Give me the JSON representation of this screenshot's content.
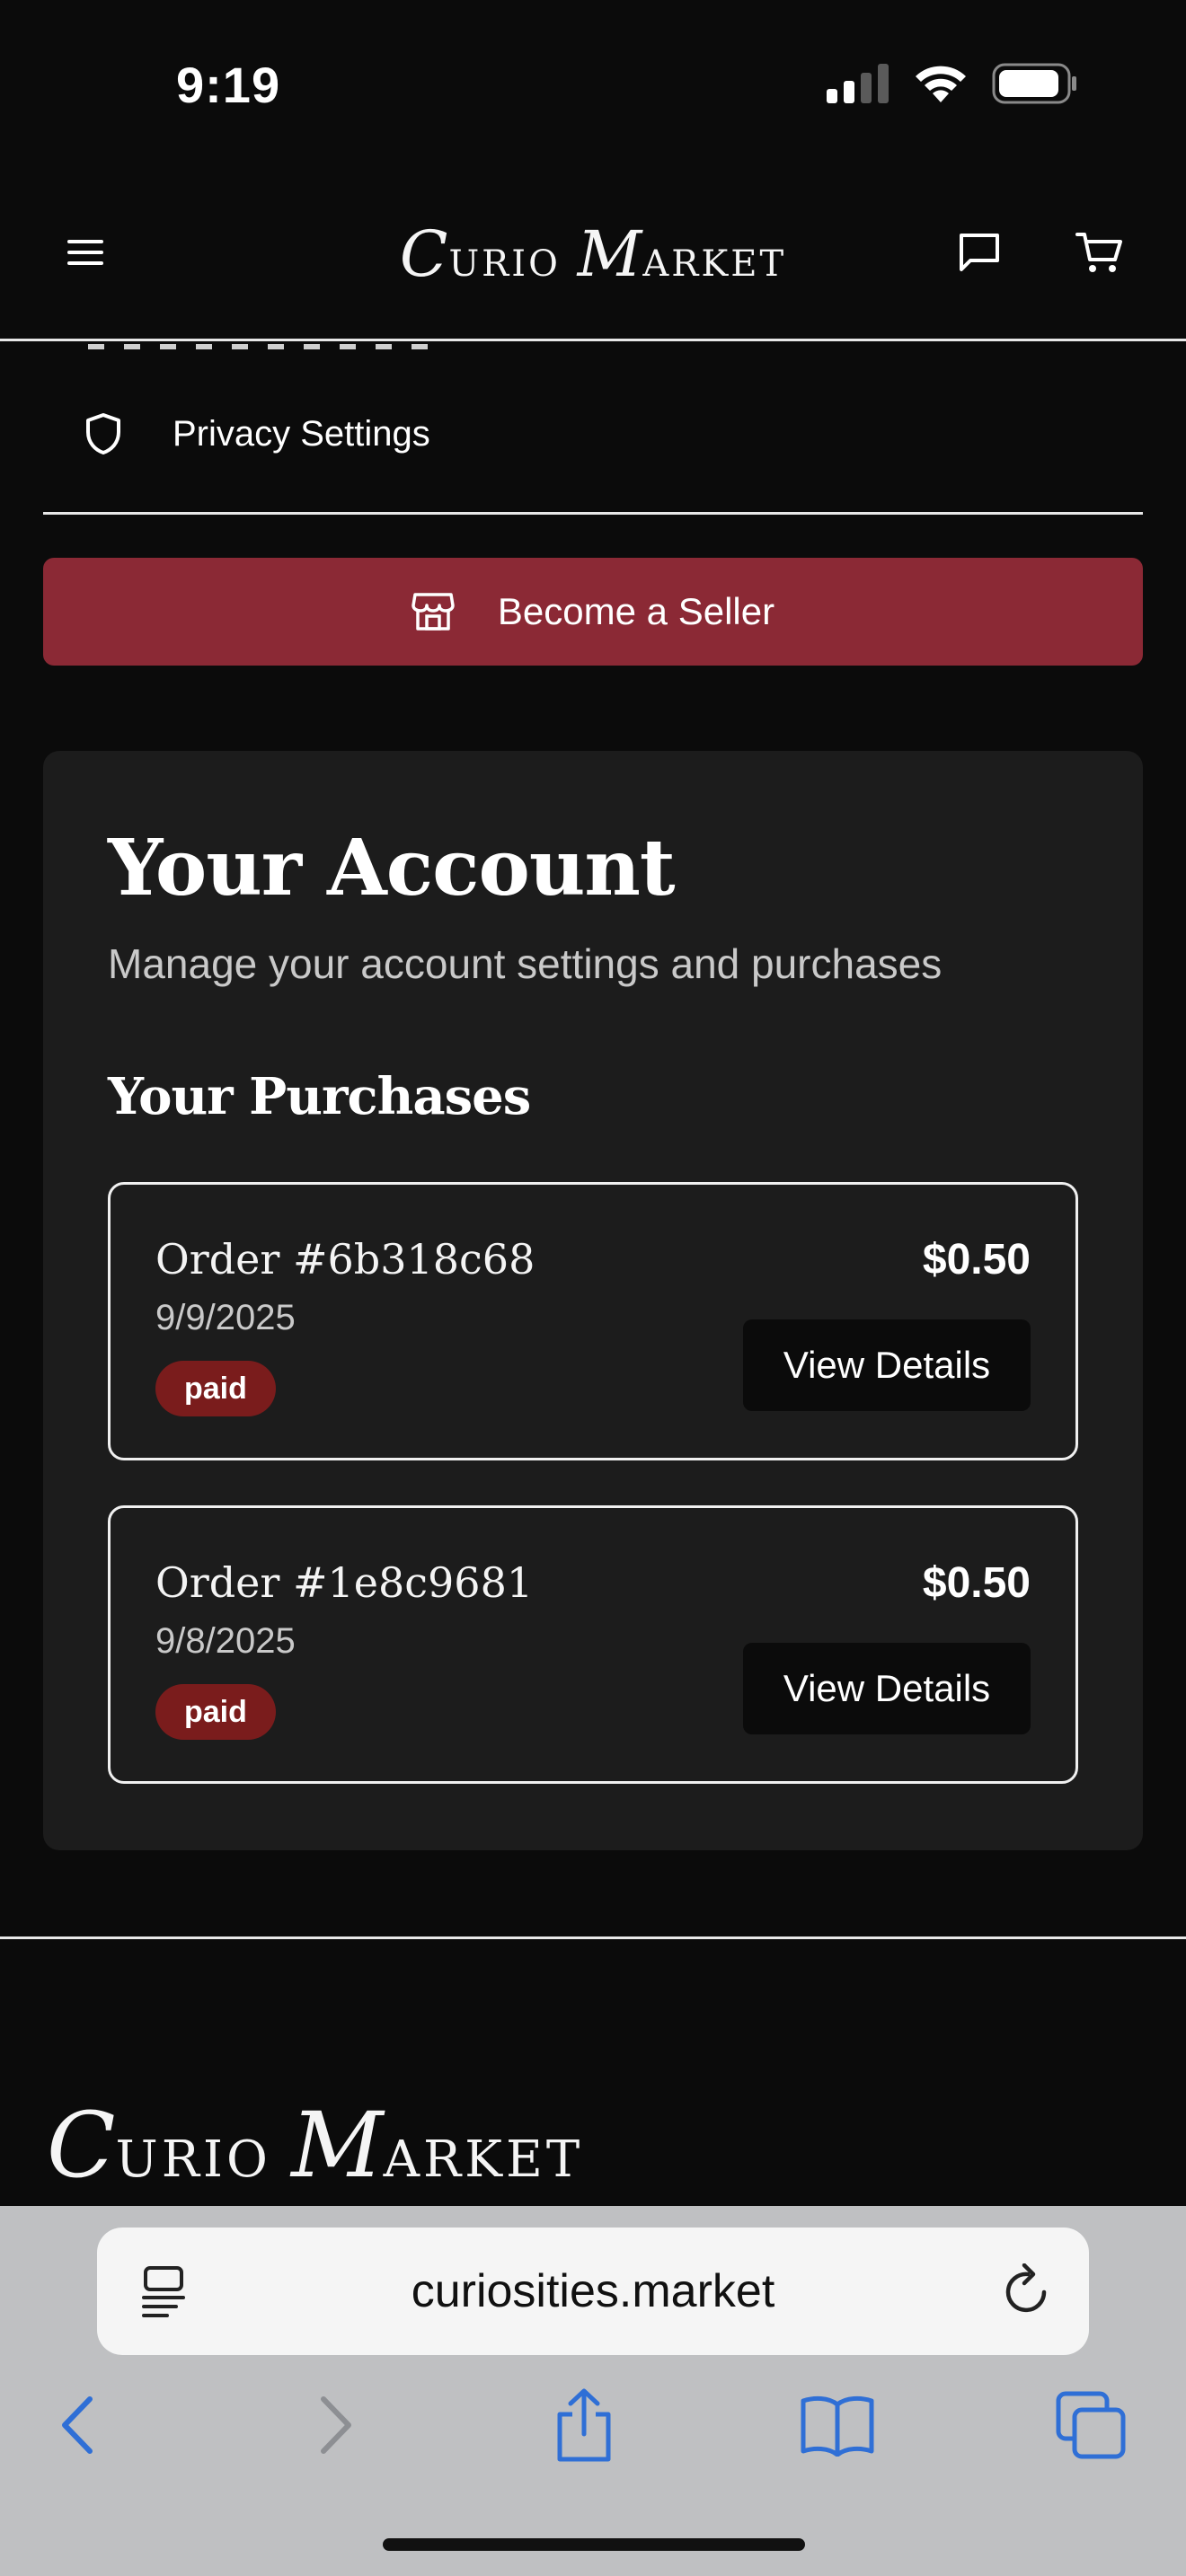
{
  "status_bar": {
    "time": "9:19"
  },
  "header": {
    "brand_first_cap": "C",
    "brand_first_rest": "URIO",
    "brand_second_cap": "M",
    "brand_second_rest": "ARKET"
  },
  "menu": {
    "privacy_label": "Privacy Settings"
  },
  "seller_button": {
    "label": "Become a Seller"
  },
  "account": {
    "title": "Your Account",
    "subtitle": "Manage your account settings and purchases",
    "purchases_title": "Your Purchases",
    "orders": [
      {
        "id": "Order #6b318c68",
        "date": "9/9/2025",
        "status": "paid",
        "price": "$0.50",
        "action": "View Details"
      },
      {
        "id": "Order #1e8c9681",
        "date": "9/8/2025",
        "status": "paid",
        "price": "$0.50",
        "action": "View Details"
      }
    ]
  },
  "footer": {
    "brand_first_cap": "C",
    "brand_first_rest": "URIO",
    "brand_second_cap": "M",
    "brand_second_rest": "ARKET"
  },
  "browser": {
    "url": "curiosities.market"
  },
  "colors": {
    "background": "#0b0b0b",
    "card": "#1c1c1c",
    "seller_accent": "#8b2935",
    "paid_badge": "#7a1c1c",
    "safari_blue": "#2f6fd6"
  },
  "icons": {
    "menu": "hamburger-icon",
    "chat": "chat-bubble-icon",
    "cart": "cart-icon",
    "privacy": "shield-icon",
    "seller": "storefront-icon",
    "reader": "reader-mode-icon",
    "reload": "reload-icon",
    "back": "back-arrow-icon",
    "forward": "forward-arrow-icon",
    "share": "share-icon",
    "bookmarks": "bookmarks-icon",
    "tabs": "tabs-icon"
  }
}
